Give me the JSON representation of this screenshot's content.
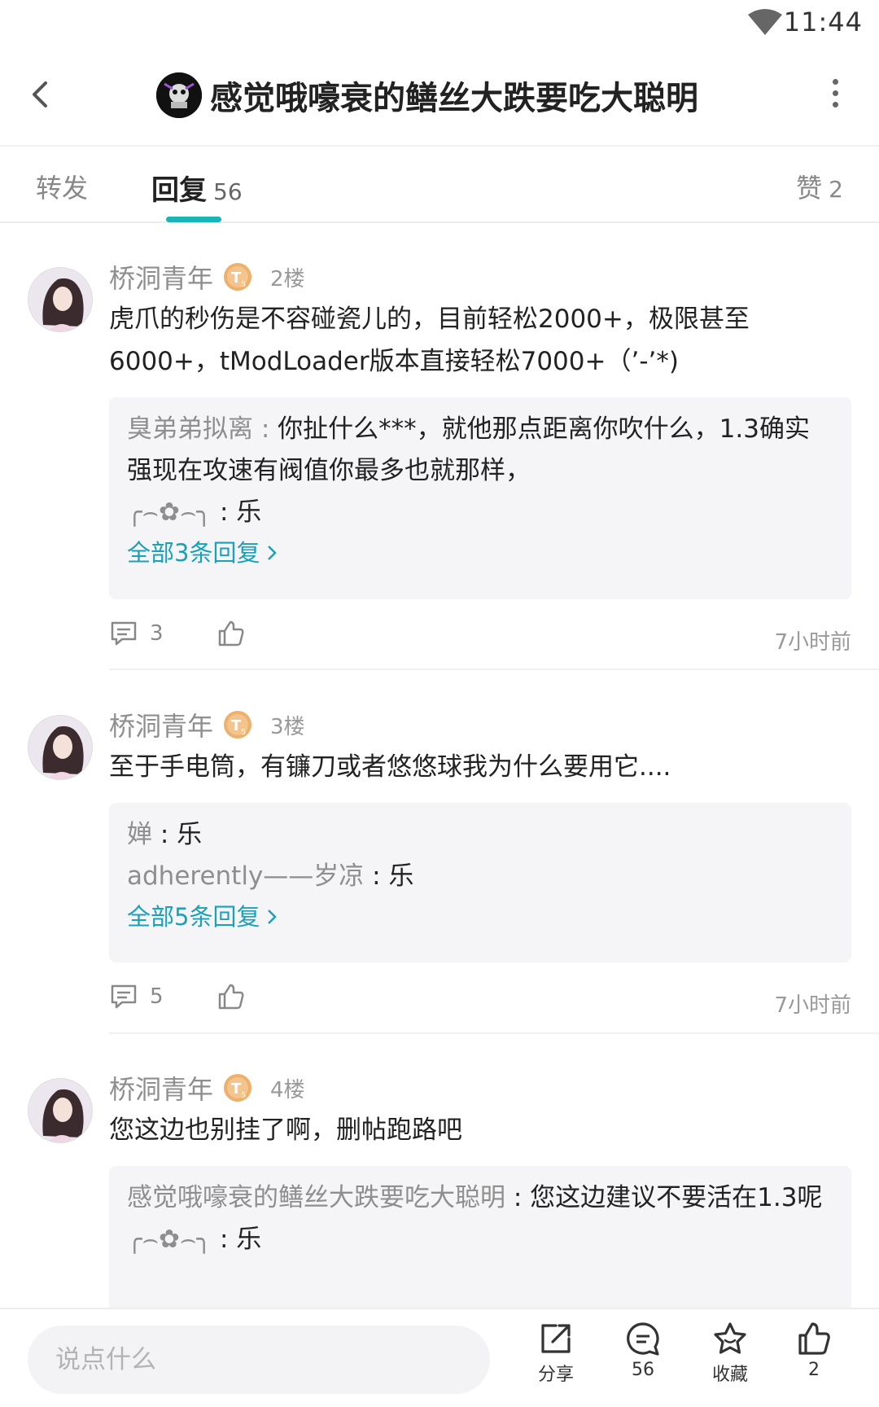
{
  "status_bar": {
    "time": "11:44"
  },
  "header": {
    "title": "感觉哦嚎衰的鳝丝大跌要吃大聪明"
  },
  "tabs": {
    "forward_label": "转发",
    "reply_label": "回复",
    "reply_count": "56",
    "like_label": "赞",
    "like_count": "2"
  },
  "posts": [
    {
      "username": "桥洞青年",
      "floor": "2楼",
      "text": "虎爪的秒伤是不容碰瓷儿的，目前轻松2000+，极限甚至6000+，tModLoader版本直接轻松7000+（’-’*)",
      "replies": [
        {
          "user": "臭弟弟拟离",
          "sep": " : ",
          "text": "你扯什么***，就他那点距离你吹什么，1.3确实强现在攻速有阀值你最多也就那样，"
        },
        {
          "user": "╭⌢✿⌢╮",
          "sep": " : ",
          "text": "乐"
        }
      ],
      "more_replies": "全部3条回复",
      "comment_count": "3",
      "time": "7小时前"
    },
    {
      "username": "桥洞青年",
      "floor": "3楼",
      "text": "至于手电筒，有镰刀或者悠悠球我为什么要用它....",
      "replies": [
        {
          "user": "婵",
          "sep": " : ",
          "text": "乐"
        },
        {
          "user": "adherently——岁凉",
          "sep": " : ",
          "text": "乐"
        }
      ],
      "more_replies": "全部5条回复",
      "comment_count": "5",
      "time": "7小时前"
    },
    {
      "username": "桥洞青年",
      "floor": "4楼",
      "text": "您这边也别挂了啊，删帖跑路吧",
      "replies": [
        {
          "user": "感觉哦嚎衰的鳝丝大跌要吃大聪明",
          "sep": " : ",
          "text": "您这边建议不要活在1.3呢"
        },
        {
          "user": "╭⌢✿⌢╮",
          "sep": " : ",
          "text": "乐"
        }
      ]
    }
  ],
  "bottom_bar": {
    "input_placeholder": "说点什么",
    "share_label": "分享",
    "comments_count": "56",
    "collect_label": "收藏",
    "like_count": "2"
  },
  "colors": {
    "accent": "#1ab3b8",
    "link": "#1aa0b8",
    "badge": "#e9a35c"
  }
}
